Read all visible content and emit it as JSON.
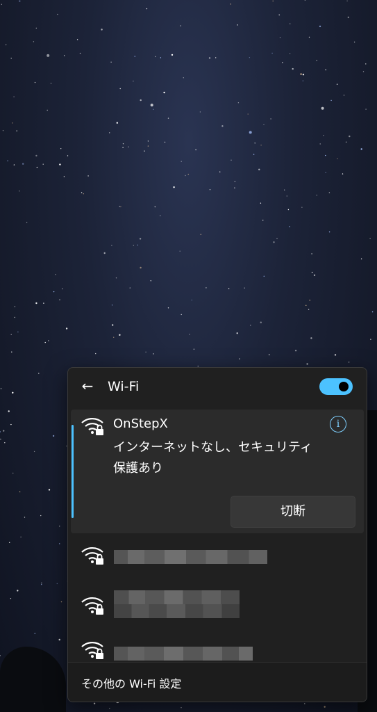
{
  "wifi_panel": {
    "title": "Wi-Fi",
    "back_icon": "back-arrow-icon",
    "wifi_enabled": true,
    "accent_color": "#4cc2ff",
    "connected_network": {
      "ssid": "OnStepX",
      "status": "インターネットなし、セキュリティ保護あり",
      "disconnect_label": "切断",
      "icon": "wifi-secured-icon",
      "info_icon": "info-icon"
    },
    "other_networks": [
      {
        "ssid": "",
        "icon": "wifi-secured-icon"
      },
      {
        "ssid": "",
        "icon": "wifi-secured-icon"
      },
      {
        "ssid": "",
        "icon": "wifi-secured-icon"
      }
    ],
    "footer_label": "その他の Wi-Fi 設定"
  }
}
